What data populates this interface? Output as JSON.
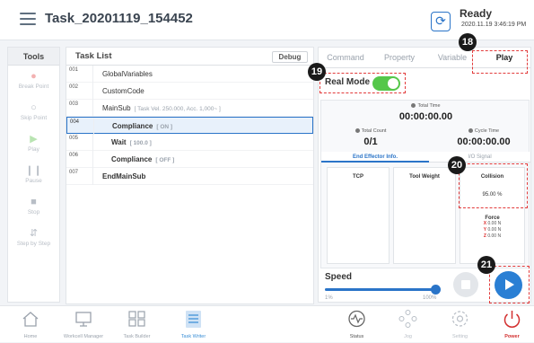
{
  "header": {
    "task_title": "Task_20201119_154452",
    "status": "Ready",
    "status_time": "2020.11.19 3:46:19 PM"
  },
  "tools": {
    "title": "Tools",
    "items": [
      {
        "label": "Break Point",
        "icon": "record-icon"
      },
      {
        "label": "Skip Point",
        "icon": "skip-icon"
      },
      {
        "label": "Play",
        "icon": "play-icon"
      },
      {
        "label": "Pause",
        "icon": "pause-icon"
      },
      {
        "label": "Stop",
        "icon": "stop-icon"
      },
      {
        "label": "Step by Step",
        "icon": "step-icon"
      }
    ]
  },
  "task_list": {
    "title": "Task List",
    "debug_label": "Debug",
    "rows": [
      {
        "num": "001",
        "cmd": "GlobalVariables",
        "param": ""
      },
      {
        "num": "002",
        "cmd": "CustomCode",
        "param": ""
      },
      {
        "num": "003",
        "cmd": "MainSub",
        "param": "[ Task Vel. 250.000, Acc. 1,000~ ]"
      },
      {
        "num": "004",
        "cmd": "Compliance",
        "param": "[ ON ]"
      },
      {
        "num": "005",
        "cmd": "Wait",
        "param": "[ 100.0 ]"
      },
      {
        "num": "006",
        "cmd": "Compliance",
        "param": "[ OFF ]"
      },
      {
        "num": "007",
        "cmd": "EndMainSub",
        "param": ""
      }
    ],
    "selected_index": 3
  },
  "right_panel": {
    "tabs": [
      "Command",
      "Property",
      "Variable",
      "Play"
    ],
    "active_tab": "Play",
    "real_mode_label": "Real Mode",
    "real_mode_on": true,
    "total_time_label": "Total Time",
    "total_time": "00:00:00.00",
    "total_count_label": "Total Count",
    "total_count": "0/1",
    "cycle_time_label": "Cycle Time",
    "cycle_time": "00:00:00.00",
    "subtabs": [
      "End Effector Info.",
      "I/O Signal"
    ],
    "active_subtab": "End Effector Info.",
    "tcp_label": "TCP",
    "tool_weight_label": "Tool Weight",
    "collision_label": "Collision",
    "collision_value": "95.00 %",
    "force_label": "Force",
    "force": [
      {
        "axis": "X",
        "value": "0.00 N"
      },
      {
        "axis": "Y",
        "value": "0.00 N"
      },
      {
        "axis": "Z",
        "value": "0.00 N"
      }
    ],
    "speed_label": "Speed",
    "speed_min": "1%",
    "speed_max": "100%",
    "speed_value_percent": 100
  },
  "callouts": [
    "18",
    "19",
    "20",
    "21"
  ],
  "bottom_nav": [
    {
      "label": "Home",
      "icon": "home-icon"
    },
    {
      "label": "Workcell Manager",
      "icon": "workcell-icon"
    },
    {
      "label": "Task Builder",
      "icon": "task-builder-icon"
    },
    {
      "label": "Task Writer",
      "icon": "task-writer-icon"
    },
    {
      "label": "Status",
      "icon": "status-icon"
    },
    {
      "label": "Jog",
      "icon": "jog-icon"
    },
    {
      "label": "Setting",
      "icon": "setting-icon"
    },
    {
      "label": "Power",
      "icon": "power-icon"
    }
  ],
  "colors": {
    "accent": "#2a74c8",
    "callout_border": "#e23b3b",
    "toggle_on": "#55c74a",
    "power": "#d32f2f"
  }
}
